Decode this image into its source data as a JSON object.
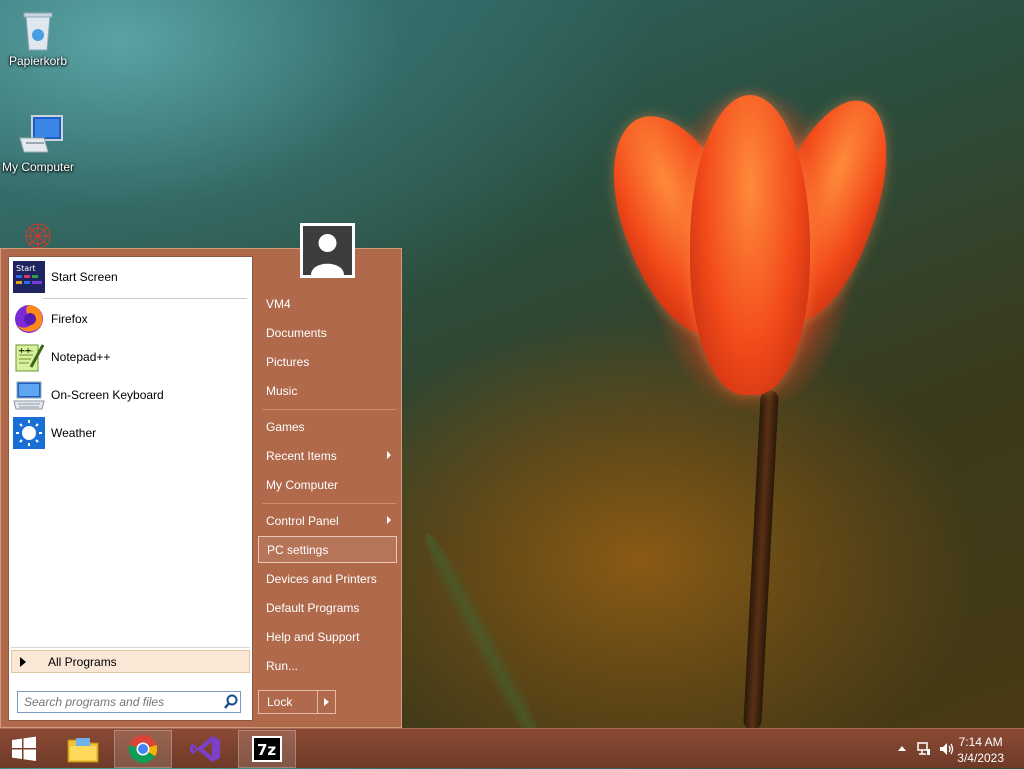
{
  "desktop": {
    "icons": [
      {
        "label": "Papierkorb",
        "icon": "recycle-bin-icon"
      },
      {
        "label": "My Computer",
        "icon": "computer-icon"
      }
    ]
  },
  "start_menu": {
    "programs": [
      {
        "label": "Start Screen",
        "icon": "start-screen-icon"
      },
      {
        "label": "Firefox",
        "icon": "firefox-icon"
      },
      {
        "label": "Notepad++",
        "icon": "notepad-plus-icon"
      },
      {
        "label": "On-Screen Keyboard",
        "icon": "keyboard-icon"
      },
      {
        "label": "Weather",
        "icon": "weather-icon"
      }
    ],
    "start_tile_text": "Start",
    "all_programs": "All Programs",
    "search_placeholder": "Search programs and files",
    "right_items": [
      {
        "label": "VM4"
      },
      {
        "label": "Documents"
      },
      {
        "label": "Pictures"
      },
      {
        "label": "Music"
      },
      {
        "label": "Games"
      },
      {
        "label": "Recent Items",
        "submenu": true
      },
      {
        "label": "My Computer"
      },
      {
        "label": "Control Panel",
        "submenu": true
      },
      {
        "label": "PC settings",
        "highlighted": true
      },
      {
        "label": "Devices and Printers"
      },
      {
        "label": "Default Programs"
      },
      {
        "label": "Help and Support"
      },
      {
        "label": "Run..."
      }
    ],
    "lock_label": "Lock"
  },
  "taskbar": {
    "pinned": [
      {
        "name": "start-button",
        "icon": "windows-logo-icon"
      },
      {
        "name": "file-explorer",
        "icon": "folder-icon"
      },
      {
        "name": "chrome",
        "icon": "chrome-icon",
        "active": true
      },
      {
        "name": "visual-studio",
        "icon": "visual-studio-icon"
      },
      {
        "name": "7zip",
        "icon": "7zip-icon",
        "active": true
      }
    ],
    "seven_zip_text": "7z",
    "clock_time": "7:14 AM",
    "clock_date": "3/4/2023"
  },
  "colors": {
    "menu_bg": "#b0694b",
    "taskbar_bg": "#7a4030",
    "all_programs_bg": "#fbe7d6"
  }
}
